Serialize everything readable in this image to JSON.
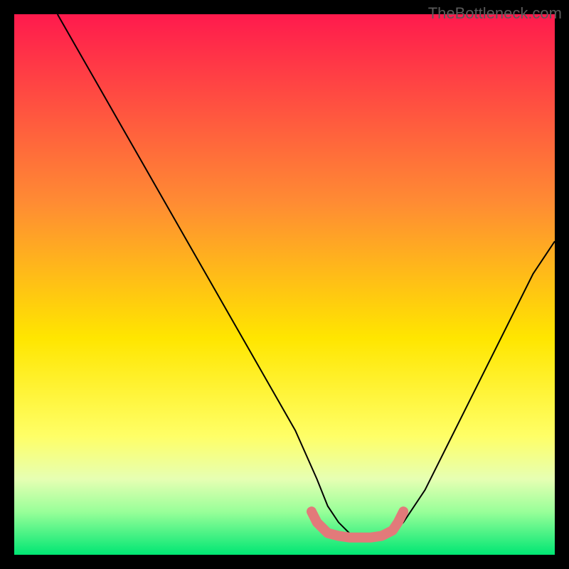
{
  "watermark": "TheBottleneck.com",
  "chart_data": {
    "type": "line",
    "title": "",
    "xlabel": "",
    "ylabel": "",
    "xlim": [
      0,
      100
    ],
    "ylim": [
      0,
      100
    ],
    "gradient_stops": [
      {
        "offset": 0,
        "color": "#ff1a4d"
      },
      {
        "offset": 35,
        "color": "#ff8c33"
      },
      {
        "offset": 60,
        "color": "#ffe600"
      },
      {
        "offset": 78,
        "color": "#ffff66"
      },
      {
        "offset": 86,
        "color": "#e6ffb3"
      },
      {
        "offset": 92,
        "color": "#99ff99"
      },
      {
        "offset": 100,
        "color": "#00e673"
      }
    ],
    "series": [
      {
        "name": "curve",
        "color": "#000000",
        "x": [
          8,
          12,
          16,
          20,
          24,
          28,
          32,
          36,
          40,
          44,
          48,
          52,
          56,
          58,
          60,
          62,
          64,
          66,
          68,
          70,
          72,
          76,
          80,
          84,
          88,
          92,
          96,
          100
        ],
        "y": [
          100,
          93,
          86,
          79,
          72,
          65,
          58,
          51,
          44,
          37,
          30,
          23,
          14,
          9,
          6,
          4,
          3,
          3,
          3,
          4,
          6,
          12,
          20,
          28,
          36,
          44,
          52,
          58
        ]
      },
      {
        "name": "optimal-zone",
        "color": "#e27a7a",
        "stroke_width": 10,
        "x": [
          55,
          56,
          57,
          58,
          60,
          62,
          64,
          66,
          68,
          70,
          71,
          72
        ],
        "y": [
          8,
          6,
          5,
          4,
          3.5,
          3.2,
          3.2,
          3.2,
          3.5,
          4.5,
          6,
          8
        ]
      }
    ]
  }
}
